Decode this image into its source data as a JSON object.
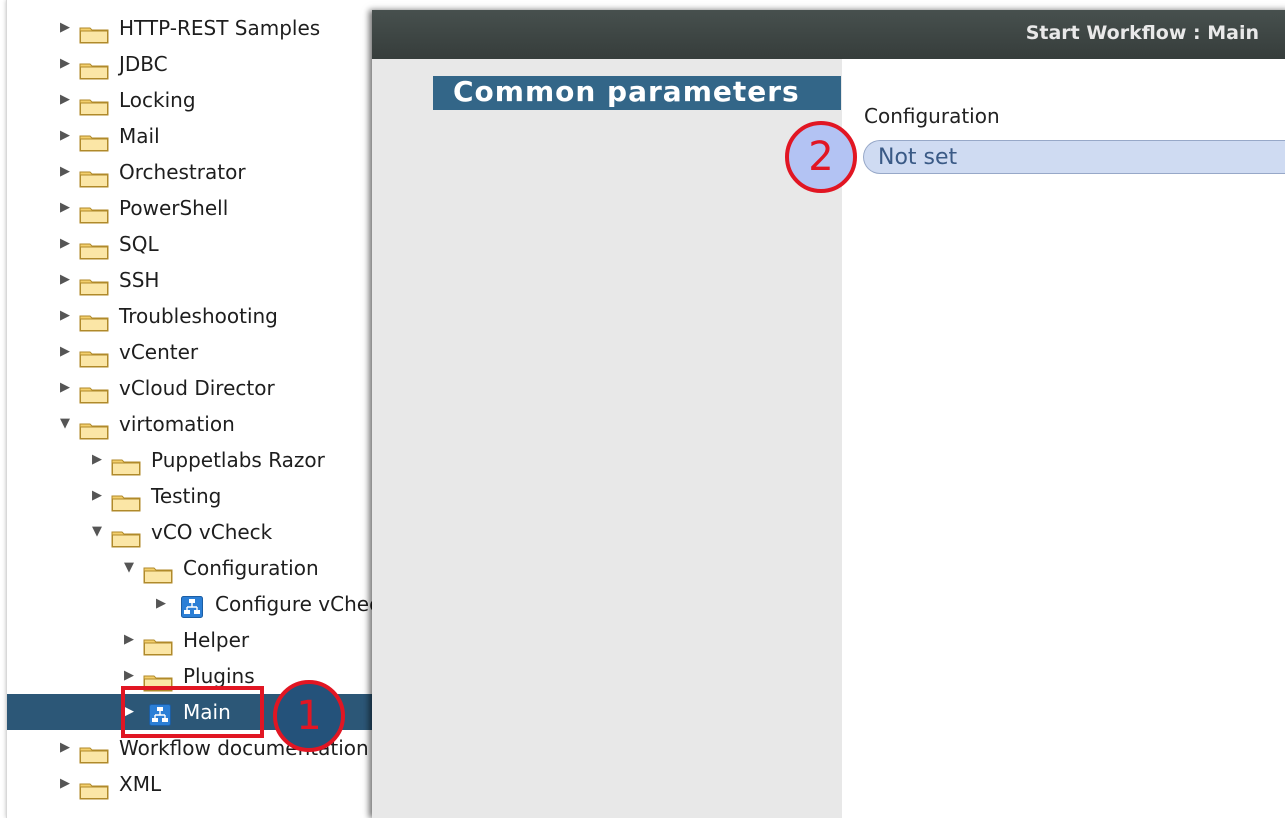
{
  "tree": {
    "items": [
      {
        "label": "HTTP-REST Samples",
        "expanded": false,
        "type": "folder",
        "level": 0
      },
      {
        "label": "JDBC",
        "expanded": false,
        "type": "folder",
        "level": 0
      },
      {
        "label": "Locking",
        "expanded": false,
        "type": "folder",
        "level": 0
      },
      {
        "label": "Mail",
        "expanded": false,
        "type": "folder",
        "level": 0
      },
      {
        "label": "Orchestrator",
        "expanded": false,
        "type": "folder",
        "level": 0
      },
      {
        "label": "PowerShell",
        "expanded": false,
        "type": "folder",
        "level": 0
      },
      {
        "label": "SQL",
        "expanded": false,
        "type": "folder",
        "level": 0
      },
      {
        "label": "SSH",
        "expanded": false,
        "type": "folder",
        "level": 0
      },
      {
        "label": "Troubleshooting",
        "expanded": false,
        "type": "folder",
        "level": 0
      },
      {
        "label": "vCenter",
        "expanded": false,
        "type": "folder",
        "level": 0
      },
      {
        "label": "vCloud Director",
        "expanded": false,
        "type": "folder",
        "level": 0
      },
      {
        "label": "virtomation",
        "expanded": true,
        "type": "folder",
        "level": 0
      },
      {
        "label": "Puppetlabs Razor",
        "expanded": false,
        "type": "folder",
        "level": 1
      },
      {
        "label": "Testing",
        "expanded": false,
        "type": "folder",
        "level": 1
      },
      {
        "label": "vCO vCheck",
        "expanded": true,
        "type": "folder",
        "level": 1
      },
      {
        "label": "Configuration",
        "expanded": true,
        "type": "folder",
        "level": 2
      },
      {
        "label": "Configure vCheck",
        "expanded": false,
        "type": "workflow",
        "level": 3
      },
      {
        "label": "Helper",
        "expanded": false,
        "type": "folder",
        "level": 2
      },
      {
        "label": "Plugins",
        "expanded": false,
        "type": "folder",
        "level": 2
      },
      {
        "label": "Main",
        "expanded": false,
        "type": "workflow",
        "level": 2,
        "selected": true
      },
      {
        "label": "Workflow documentation",
        "expanded": false,
        "type": "folder",
        "level": 0
      },
      {
        "label": "XML",
        "expanded": false,
        "type": "folder",
        "level": 0
      }
    ]
  },
  "dialog": {
    "title": "Start Workflow : Main",
    "section_tab": "Common parameters",
    "config_label": "Configuration",
    "config_value": "Not set"
  },
  "annotations": {
    "callout_1": "1",
    "callout_2": "2"
  },
  "colors": {
    "selection": "#2c5777",
    "section_tab": "#336688",
    "header": "#3d4543",
    "annotation_red": "#e11623",
    "field_fill": "#cfdbf2",
    "folder": "#f7dc8a"
  },
  "icons": {
    "collapsed": "triangle-right-icon",
    "expanded": "triangle-down-icon",
    "folder": "folder-icon",
    "workflow": "workflow-icon"
  }
}
